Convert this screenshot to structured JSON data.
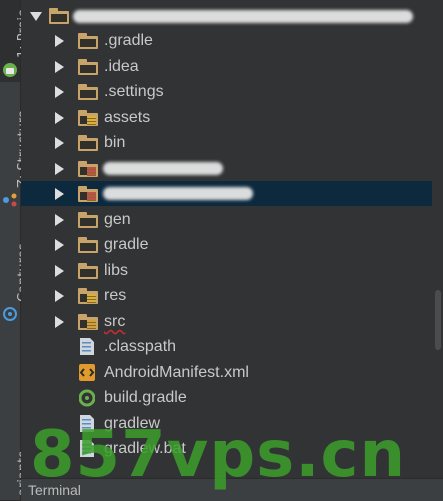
{
  "toolstrip": {
    "project_tab": "1: Proje",
    "structure_tab": "Z: Structure",
    "captures_tab": "Captures",
    "variants_tab": "ariants"
  },
  "tree": {
    "root_label": "",
    "items": [
      {
        "label": ".gradle",
        "kind": "folder"
      },
      {
        "label": ".idea",
        "kind": "folder"
      },
      {
        "label": ".settings",
        "kind": "folder"
      },
      {
        "label": "assets",
        "kind": "resource-folder"
      },
      {
        "label": "bin",
        "kind": "folder"
      },
      {
        "label": "",
        "kind": "redacted-folder"
      },
      {
        "label": "",
        "kind": "redacted-folder-selected"
      },
      {
        "label": "gen",
        "kind": "folder"
      },
      {
        "label": "gradle",
        "kind": "folder"
      },
      {
        "label": "libs",
        "kind": "folder"
      },
      {
        "label": "res",
        "kind": "resource-folder"
      },
      {
        "label": "src",
        "kind": "source-folder"
      },
      {
        "label": ".classpath",
        "kind": "file"
      },
      {
        "label": "AndroidManifest.xml",
        "kind": "xml-file"
      },
      {
        "label": "build.gradle",
        "kind": "gradle-file"
      },
      {
        "label": "gradlew",
        "kind": "file"
      },
      {
        "label": "gradlew.bat",
        "kind": "file"
      }
    ]
  },
  "bottom": {
    "terminal_label": "Terminal"
  },
  "watermark": "857vps.cn",
  "colors": {
    "selection": "#0d293e",
    "folder": "#c8a46a",
    "background": "#313335"
  }
}
